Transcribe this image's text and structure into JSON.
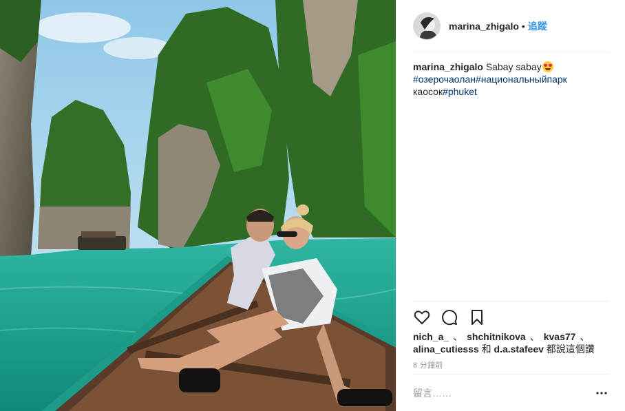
{
  "post": {
    "username": "marina_zhigalo",
    "dot": "•",
    "follow_label": "追蹤"
  },
  "caption": {
    "username": "marina_zhigalo",
    "text": "Sabay sabay",
    "emoji": "heart-eyes-emoji",
    "hashtags": [
      "#озерочаолан",
      "#национальныйпарк",
      "каосок",
      "#phuket"
    ]
  },
  "actions": {
    "like_icon": "heart-icon",
    "comment_icon": "comment-icon",
    "save_icon": "bookmark-icon"
  },
  "likes": {
    "users": [
      "nich_a_",
      "shchitnikova",
      "kvas77",
      "alina_cutiesss"
    ],
    "separator": "、",
    "and_word": "和",
    "last_user": "d.a.stafeev",
    "suffix": "都說這個讚"
  },
  "time": "8 分鐘前",
  "comment": {
    "placeholder": "留言……",
    "more_icon": "more-options-icon"
  },
  "colors": {
    "link": "#003569",
    "follow": "#3897f0",
    "muted": "#999999",
    "water": "#1aa894"
  }
}
